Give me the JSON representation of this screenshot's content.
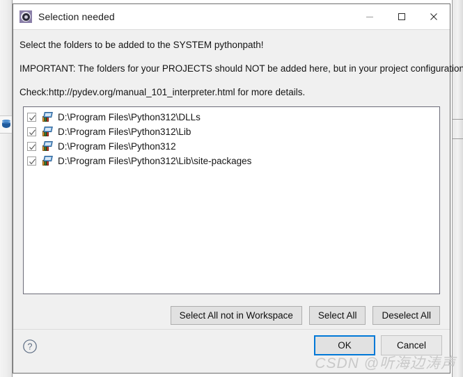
{
  "window": {
    "title": "Selection needed",
    "icon": "pydev-gear-icon",
    "controls": {
      "minimize": "minimize-icon",
      "maximize": "maximize-icon",
      "close": "close-icon"
    }
  },
  "messages": [
    "Select the folders to be added to the SYSTEM pythonpath!",
    "IMPORTANT: The folders for your PROJECTS should NOT be added here, but in your project configuration.",
    "Check:http://pydev.org/manual_101_interpreter.html for more details."
  ],
  "list": {
    "items": [
      {
        "label": "D:\\Program Files\\Python312\\DLLs",
        "checked": true,
        "icon": "library-folder-icon"
      },
      {
        "label": "D:\\Program Files\\Python312\\Lib",
        "checked": true,
        "icon": "library-folder-icon"
      },
      {
        "label": "D:\\Program Files\\Python312",
        "checked": true,
        "icon": "library-folder-icon"
      },
      {
        "label": "D:\\Program Files\\Python312\\Lib\\site-packages",
        "checked": true,
        "icon": "library-folder-icon"
      }
    ]
  },
  "select_buttons": {
    "select_all_not_in_workspace": "Select All not in Workspace",
    "select_all": "Select All",
    "deselect_all": "Deselect All"
  },
  "footer": {
    "help": "help-icon",
    "ok": "OK",
    "cancel": "Cancel"
  },
  "watermark": "CSDN @听海边涛声",
  "colors": {
    "accent_focus": "#0078D7",
    "dialog_background": "#F0F0F0",
    "list_background": "#FFFFFF",
    "button_face": "#E1E1E1",
    "title_icon": "#8A7FA8"
  }
}
